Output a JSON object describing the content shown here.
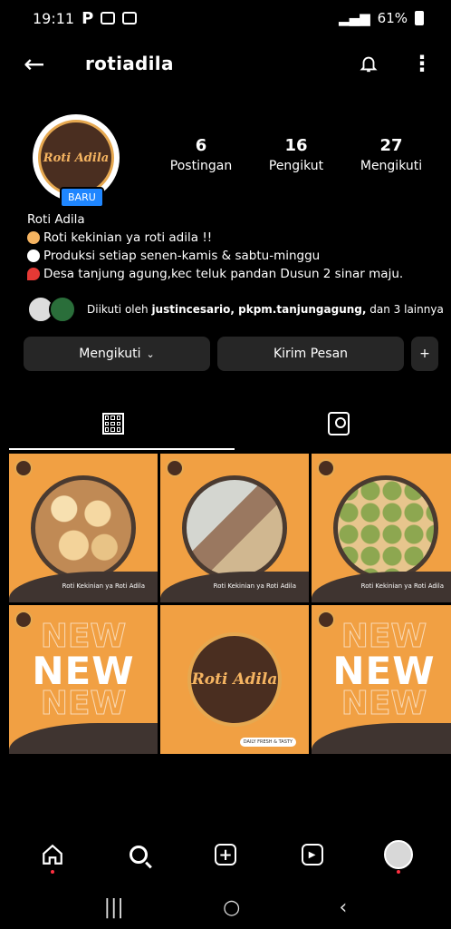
{
  "status_bar": {
    "time": "19:11",
    "battery": "61%"
  },
  "header": {
    "username": "rotiadila"
  },
  "profile": {
    "avatar_text": "Roti Adila",
    "badge": "BARU",
    "stats": [
      {
        "num": "6",
        "label": "Postingan"
      },
      {
        "num": "16",
        "label": "Pengikut"
      },
      {
        "num": "27",
        "label": "Mengikuti"
      }
    ],
    "name": "Roti Adila",
    "bio": [
      "Roti kekinian ya roti adila !!",
      "Produksi setiap senen-kamis & sabtu-minggu",
      "Desa tanjung agung,kec teluk pandan Dusun 2 sinar maju."
    ],
    "followed_prefix": "Diikuti oleh ",
    "followed_names": "justincesario, pkpm.tanjungagung,",
    "followed_suffix": " dan 3 lainnya"
  },
  "actions": {
    "follow": "Mengikuti",
    "message": "Kirim Pesan",
    "add": "+"
  },
  "posts": [
    {
      "type": "photo",
      "caption": "Roti Kekinian ya Roti Adila"
    },
    {
      "type": "photo",
      "caption": "Roti Kekinian ya Roti Adila"
    },
    {
      "type": "photo",
      "caption": "Roti Kekinian ya Roti Adila"
    },
    {
      "type": "new",
      "text": "NEW"
    },
    {
      "type": "logo",
      "text": "Roti Adila",
      "tagline": "DAILY FRESH & TASTY"
    },
    {
      "type": "new",
      "text": "NEW"
    }
  ],
  "colors": {
    "accent": "#f1a043",
    "brown": "#4a2e20",
    "badge": "#1f86ff"
  }
}
